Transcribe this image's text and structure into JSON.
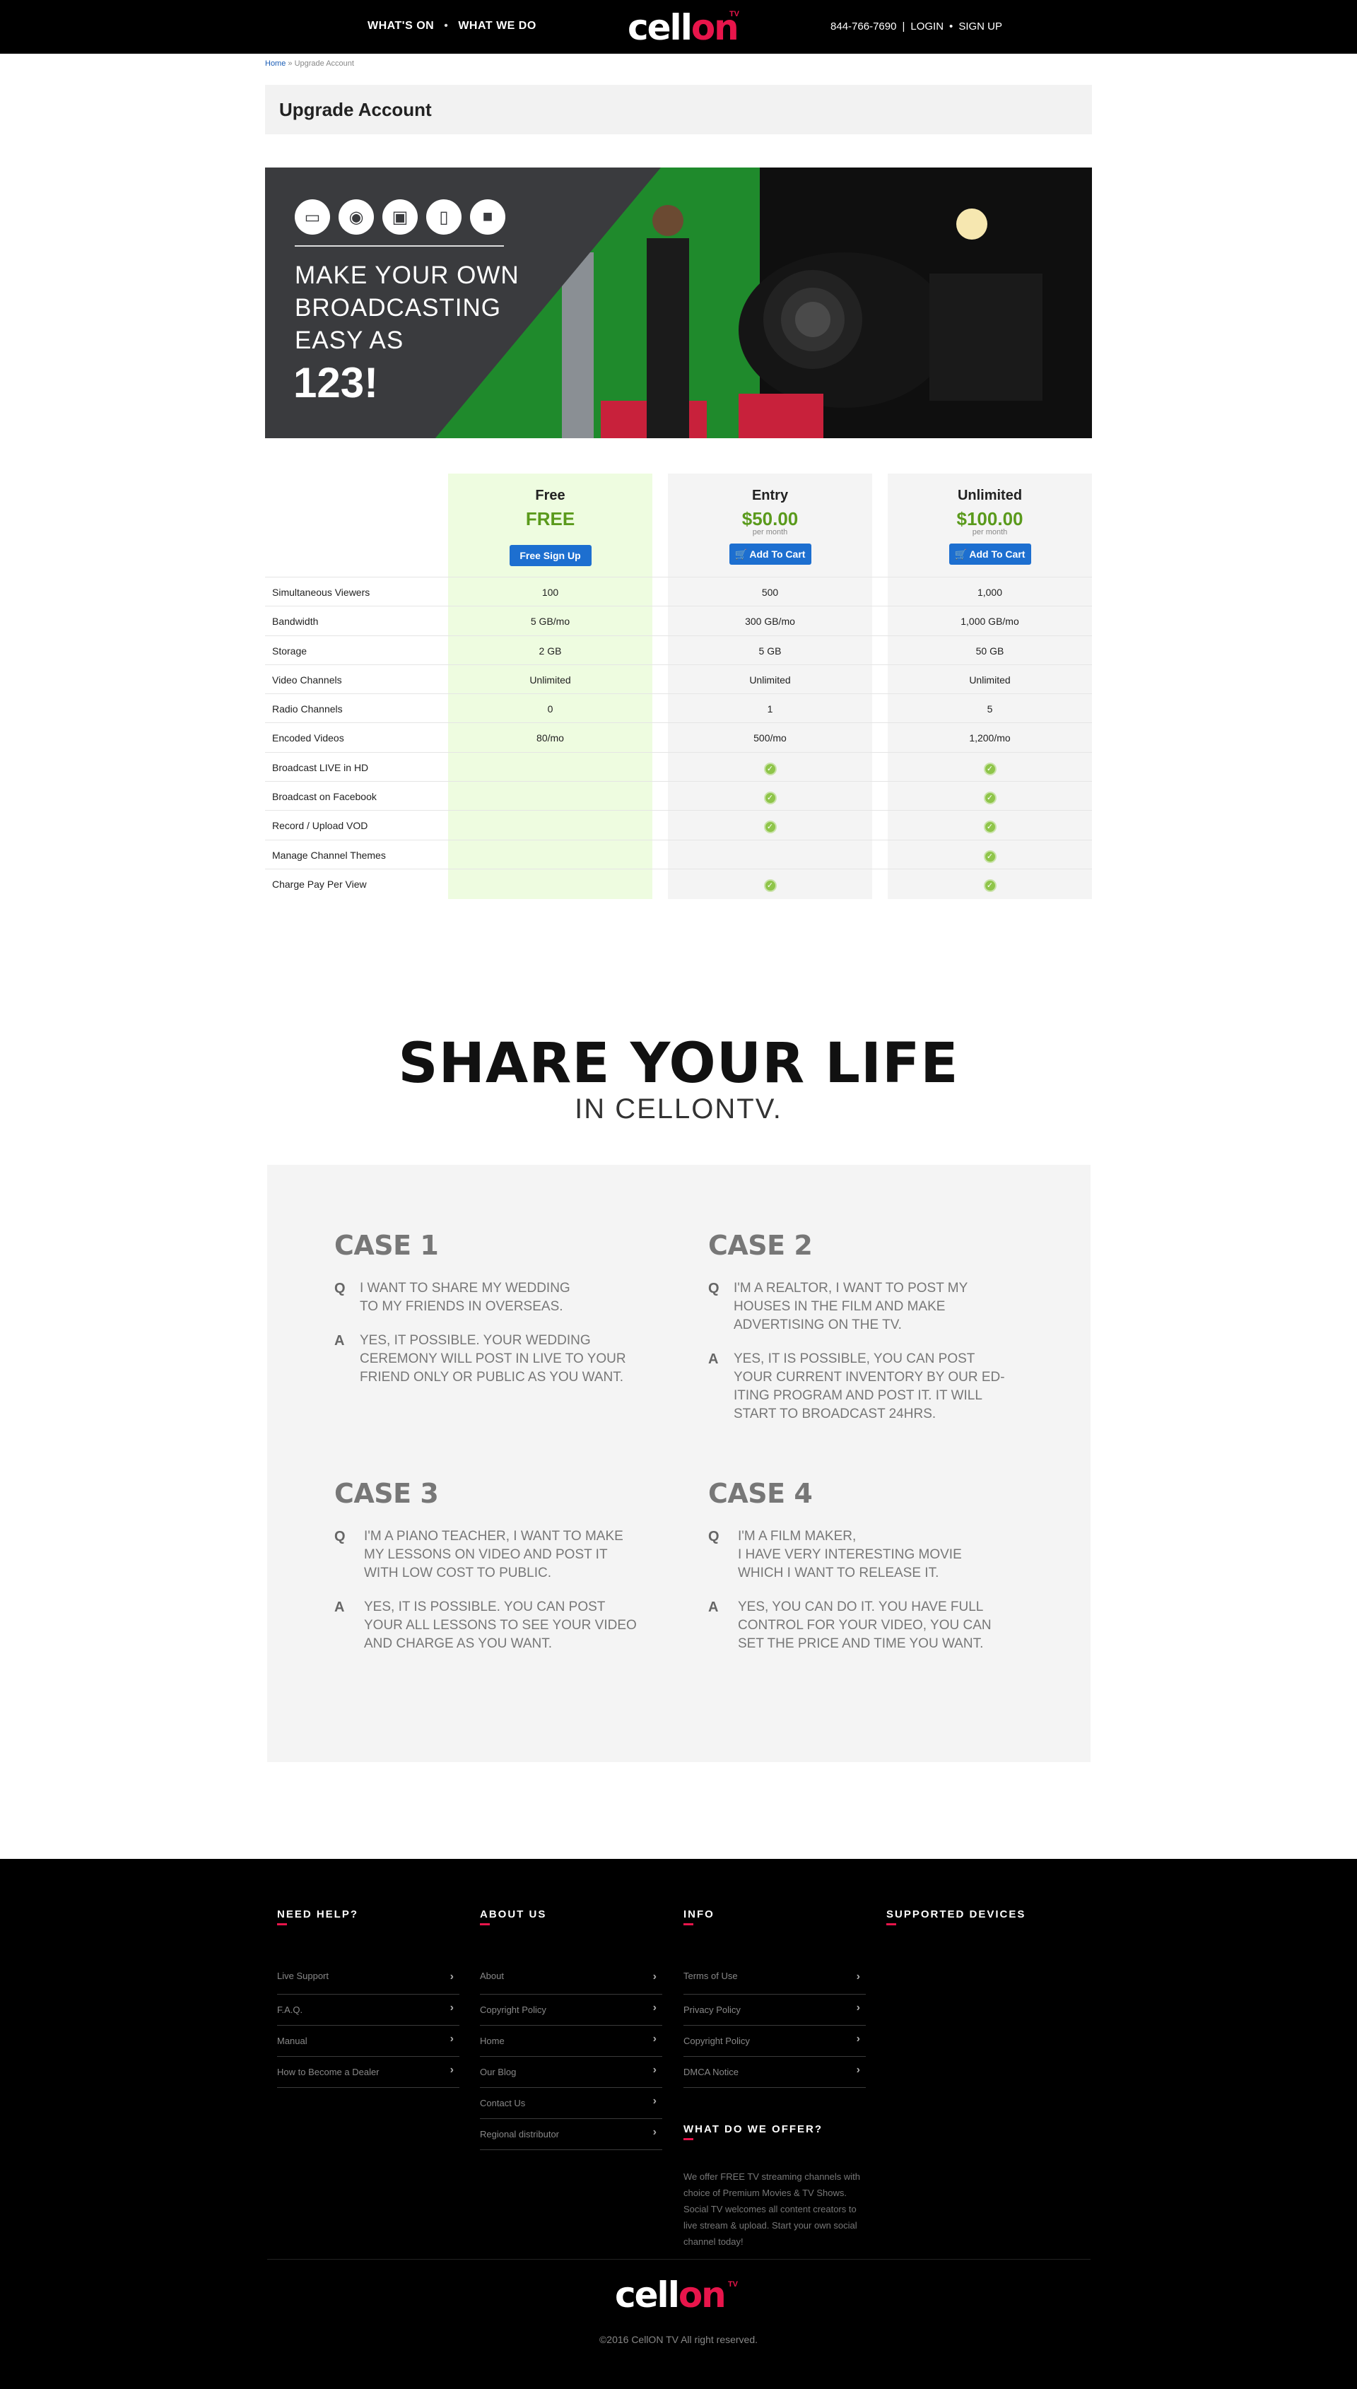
{
  "header": {
    "nav_left": [
      "WHAT'S ON",
      "WHAT WE DO"
    ],
    "logo_text_a": "cell",
    "logo_text_b": "on",
    "logo_tv": "TV",
    "phone": "844-766-7690",
    "login": "LOGIN",
    "signup": "SIGN UP"
  },
  "breadcrumb": {
    "home": "Home",
    "sep": " » ",
    "current": "Upgrade Account"
  },
  "page_title": "Upgrade Account",
  "banner": {
    "icons": [
      "laptop-icon",
      "webcam-icon",
      "camera-icon",
      "phone-icon",
      "video-camera-icon"
    ],
    "line1": "MAKE YOUR OWN",
    "line2": "BROADCASTING",
    "line3": "EASY AS",
    "big": "123!"
  },
  "plans": [
    {
      "name": "Free",
      "price": "FREE",
      "per": "",
      "button": "Free Sign Up"
    },
    {
      "name": "Entry",
      "price": "$50.00",
      "per": "per month",
      "button": "Add To Cart"
    },
    {
      "name": "Unlimited",
      "price": "$100.00",
      "per": "per month",
      "button": "Add To Cart"
    }
  ],
  "features": [
    {
      "label": "Simultaneous Viewers",
      "v": [
        "100",
        "500",
        "1,000"
      ]
    },
    {
      "label": "Bandwidth",
      "v": [
        "5 GB/mo",
        "300 GB/mo",
        "1,000 GB/mo"
      ]
    },
    {
      "label": "Storage",
      "v": [
        "2 GB",
        "5 GB",
        "50 GB"
      ]
    },
    {
      "label": "Video Channels",
      "v": [
        "Unlimited",
        "Unlimited",
        "Unlimited"
      ]
    },
    {
      "label": "Radio Channels",
      "v": [
        "0",
        "1",
        "5"
      ]
    },
    {
      "label": "Encoded Videos",
      "v": [
        "80/mo",
        "500/mo",
        "1,200/mo"
      ]
    },
    {
      "label": "Broadcast LIVE in HD",
      "check": [
        false,
        true,
        true
      ]
    },
    {
      "label": "Broadcast on Facebook",
      "check": [
        false,
        true,
        true
      ]
    },
    {
      "label": "Record / Upload VOD",
      "check": [
        false,
        true,
        true
      ]
    },
    {
      "label": "Manage Channel Themes",
      "check": [
        false,
        false,
        true
      ]
    },
    {
      "label": "Charge Pay Per View",
      "check": [
        false,
        true,
        true
      ]
    }
  ],
  "share": {
    "title": "SHARE YOUR LIFE",
    "subtitle": "IN CELLONTV."
  },
  "cases": [
    {
      "title": "CASE 1",
      "q": "I WANT TO SHARE MY WEDDING\nTO MY FRIENDS IN OVERSEAS.",
      "a": "YES, IT POSSIBLE.  YOUR WEDDING\nCEREMONY WILL POST IN LIVE TO YOUR\nFRIEND ONLY OR PUBLIC AS YOU WANT."
    },
    {
      "title": "CASE 2",
      "q": "I'M A REALTOR, I WANT TO POST MY\nHOUSES IN THE FILM AND MAKE\nADVERTISING ON THE TV.",
      "a": "YES, IT IS POSSIBLE, YOU CAN POST\nYOUR CURRENT INVENTORY BY OUR ED-\nITING PROGRAM AND POST IT. IT WILL\nSTART TO BROADCAST 24HRS."
    },
    {
      "title": "CASE 3",
      "q": "I'M A PIANO TEACHER, I WANT TO MAKE\nMY LESSONS ON VIDEO AND POST IT\nWITH LOW COST TO PUBLIC.",
      "a": "YES, IT IS POSSIBLE. YOU CAN POST\nYOUR ALL LESSONS TO SEE YOUR VIDEO\nAND CHARGE AS YOU WANT."
    },
    {
      "title": "CASE 4",
      "q": "I'M A FILM MAKER,\nI HAVE VERY INTERESTING MOVIE\nWHICH I WANT TO RELEASE IT.",
      "a": "YES, YOU CAN DO IT. YOU HAVE FULL\nCONTROL FOR YOUR VIDEO, YOU CAN\nSET THE PRICE AND TIME YOU WANT."
    }
  ],
  "qa_letters": {
    "q": "Q",
    "a": "A"
  },
  "footer": {
    "need_help": {
      "title": "NEED HELP?",
      "links": [
        "Live Support",
        "F.A.Q.",
        "Manual",
        "How to Become a Dealer"
      ]
    },
    "about_us": {
      "title": "ABOUT US",
      "links": [
        "About",
        "Copyright Policy",
        "Home",
        "Our Blog",
        "Contact Us",
        "Regional distributor"
      ]
    },
    "info": {
      "title": "INFO",
      "links": [
        "Terms of Use",
        "Privacy Policy",
        "Copyright Policy",
        "DMCA Notice"
      ]
    },
    "offer": {
      "title": "WHAT DO WE OFFER?",
      "text": "We offer FREE TV streaming channels with choice of Premium Movies & TV Shows. Social TV welcomes all content creators to live stream & upload. Start your own social channel today!"
    },
    "devices": {
      "title": "SUPPORTED DEVICES"
    },
    "copyright": "©2016 CellON TV All right reserved."
  },
  "colors": {
    "accent": "#e8154b",
    "price_green": "#5a9a1c",
    "button_blue": "#1d6fd0",
    "free_col": "#eefce0"
  }
}
